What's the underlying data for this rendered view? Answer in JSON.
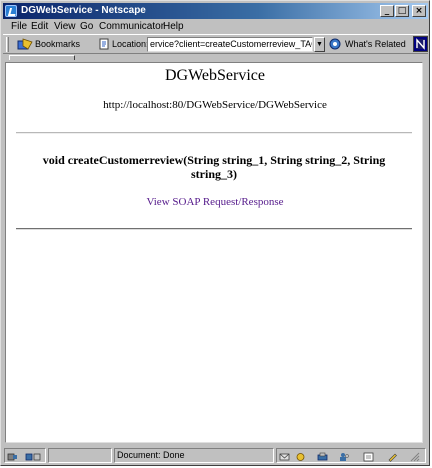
{
  "window": {
    "title": "DGWebService - Netscape",
    "controls": {
      "minimize": "_",
      "maximize": "□",
      "close": "×"
    }
  },
  "menu": [
    "File",
    "Edit",
    "View",
    "Go",
    "Communicator",
    "Help"
  ],
  "toolbar": {
    "bookmarks_label": "Bookmarks",
    "location_label": "Location:",
    "url_value": "ervice?client=createCustomerreview_TAGUID...",
    "related_label": "What's Related",
    "icons": [
      "bookmark-icon",
      "location-icon",
      "whats-related-icon",
      "netscape-throbber-icon"
    ]
  },
  "page": {
    "title": "DGWebService",
    "endpoint": "http://localhost:80/DGWebService/DGWebService",
    "method_signature": "void createCustomerreview(String string_1, String string_2, String string_3)",
    "soap_link": "View SOAP Request/Response",
    "link_color": "#551a8b"
  },
  "status": {
    "text": "Document: Done",
    "icons": [
      "connection-icon",
      "security-icon",
      "mail-icon",
      "component-icon",
      "composer-icon",
      "address-book-icon",
      "edit-icon"
    ]
  }
}
